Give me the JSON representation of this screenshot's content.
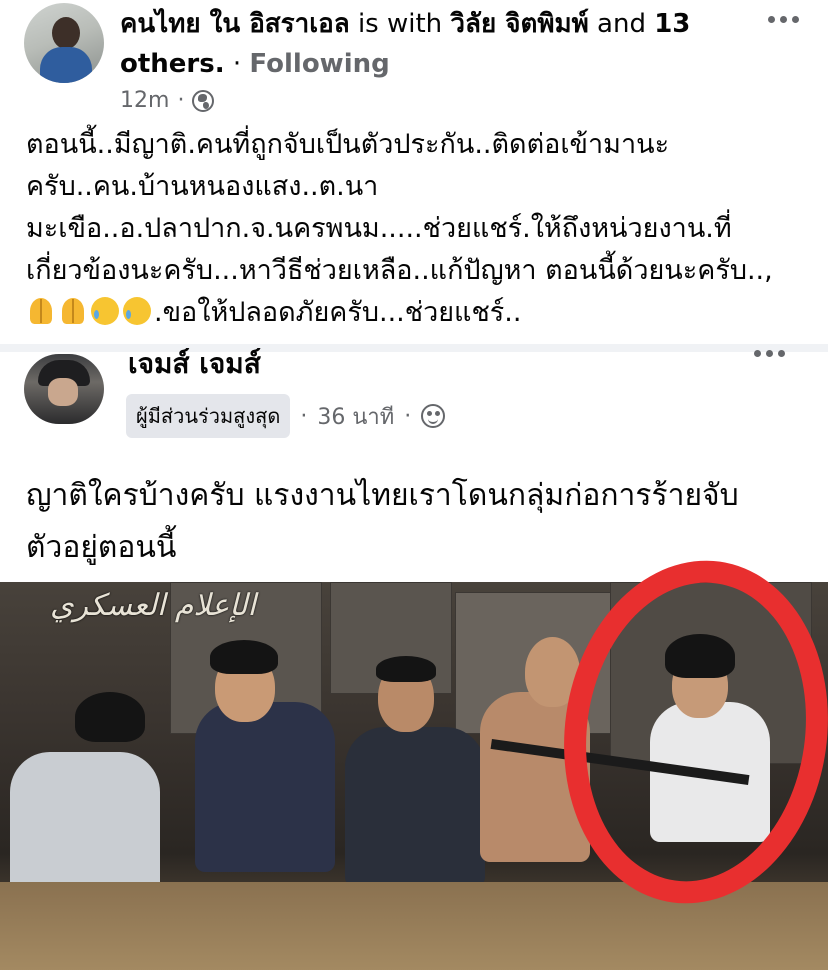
{
  "post1": {
    "author": "คนไทย ใน อิสราเอล",
    "with_word": "is with",
    "tagged": "วิลัย จิตพิมพ์",
    "and_word": "and",
    "others_count": "13",
    "others_word": "others",
    "follow_label": "Following",
    "time": "12m",
    "privacy_icon": "globe-icon",
    "lines": [
      "ตอนนี้..มีญาติ.คนที่ถูกจับเป็นตัวประกัน..ติดต่อเข้ามานะ",
      "ครับ..คน.บ้านหนองแสง..ต.นา",
      "มะเขือ..อ.ปลาปาก.จ.นครพนม.....ช่วยแชร์.ให้ถึงหน่วยงาน.ที่",
      "เกี่ยวข้องนะครับ...หาวีธีช่วยเหลือ..แก้ปัญหา ตอนนี้ด้วยนะครับ..,",
      ".ขอให้ปลอดภัยครับ...ช่วยแชร์.."
    ],
    "emoji_names": [
      "folded-hands-icon",
      "folded-hands-icon",
      "sad-tear-face-icon",
      "sad-tear-face-icon"
    ]
  },
  "post2": {
    "author": "เจมส์ เจมส์",
    "badge": "ผู้มีส่วนร่วมสูงสุด",
    "time": "36 นาที",
    "audience_icon": "friends-icon",
    "lines": [
      "ญาติใครบ้างครับ แรงงานไทยเราโดนกลุ่มก่อการร้ายจับ",
      "ตัวอยู่ตอนนี้"
    ],
    "photo_watermark": "الإعلام العسكري"
  },
  "colors": {
    "text_primary": "#050505",
    "text_secondary": "#65676b",
    "badge_bg": "#e4e6eb",
    "divider": "#f0f2f5",
    "highlight_ring": "#e82f2f"
  }
}
